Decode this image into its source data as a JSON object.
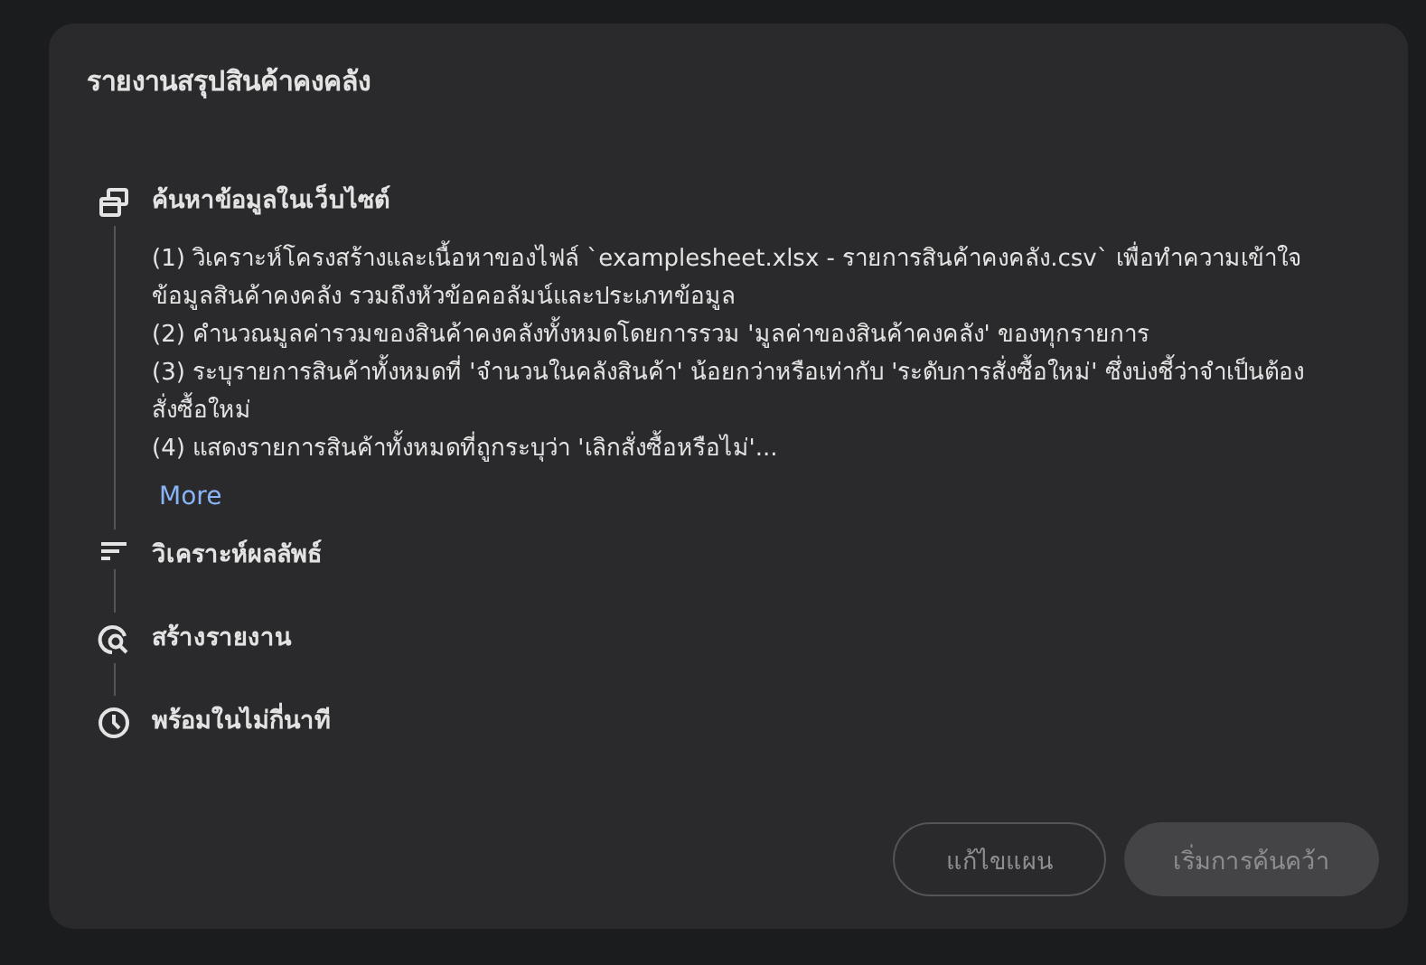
{
  "title": "รายงานสรุปสินค้าคงคลัง",
  "steps": [
    {
      "kind": "browse",
      "label": "ค้นหาข้อมูลในเว็บไซต์",
      "details": [
        "(1) วิเคราะห์โครงสร้างและเนื้อหาของไฟล์ `examplesheet.xlsx - รายการสินค้าคงคลัง.csv` เพื่อทำความเข้าใจ",
        "ข้อมูลสินค้าคงคลัง รวมถึงหัวข้อคอลัมน์และประเภทข้อมูล",
        "(2) คำนวณมูลค่ารวมของสินค้าคงคลังทั้งหมดโดยการรวม 'มูลค่าของสินค้าคงคลัง' ของทุกรายการ",
        "(3) ระบุรายการสินค้าทั้งหมดที่ 'จำนวนในคลังสินค้า' น้อยกว่าหรือเท่ากับ 'ระดับการสั่งซื้อใหม่' ซึ่งบ่งชี้ว่าจำเป็นต้อง",
        "สั่งซื้อใหม่",
        "(4) แสดงรายการสินค้าทั้งหมดที่ถูกระบุว่า 'เลิกสั่งซื้อหรือไม่'..."
      ],
      "more": "More"
    },
    {
      "kind": "analyze",
      "label": "วิเคราะห์ผลลัพธ์"
    },
    {
      "kind": "report",
      "label": "สร้างรายงาน"
    },
    {
      "kind": "time",
      "label": "พร้อมในไม่กี่นาที"
    }
  ],
  "buttons": [
    {
      "label": "แก้ไขแผน",
      "kind": "outline",
      "disabled": true
    },
    {
      "label": "เริ่มการค้นคว้า",
      "kind": "filled",
      "disabled": true
    }
  ]
}
